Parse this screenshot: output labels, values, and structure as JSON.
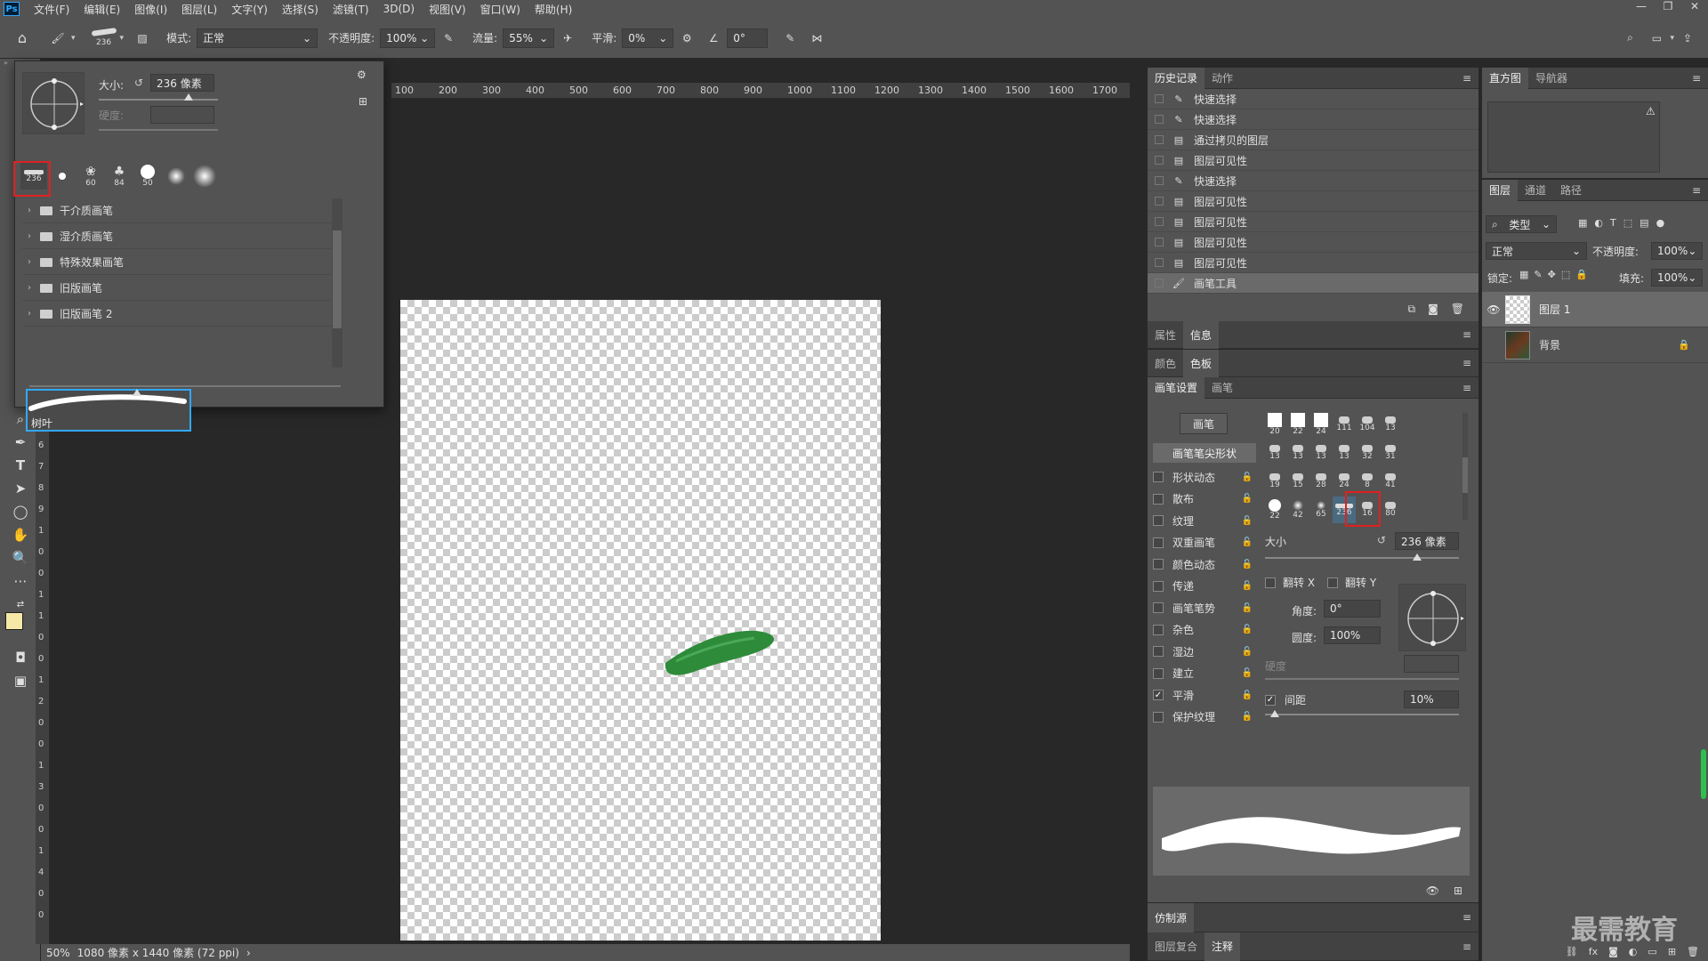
{
  "menubar": {
    "logo": "Ps",
    "items": [
      "文件(F)",
      "编辑(E)",
      "图像(I)",
      "图层(L)",
      "文字(Y)",
      "选择(S)",
      "滤镜(T)",
      "3D(D)",
      "视图(V)",
      "窗口(W)",
      "帮助(H)"
    ],
    "window_controls": [
      "—",
      "❐",
      "✕"
    ]
  },
  "options_bar": {
    "brush_size": "236",
    "mode_label": "模式:",
    "mode_value": "正常",
    "opacity_label": "不透明度:",
    "opacity_value": "100%",
    "flow_label": "流量:",
    "flow_value": "55%",
    "smooth_label": "平滑:",
    "smooth_value": "0%",
    "angle_value": "0°"
  },
  "brush_popup": {
    "size_label": "大小:",
    "size_value": "236 像素",
    "hardness_label": "硬度:",
    "presets": [
      {
        "label": "236"
      },
      {
        "label": ""
      },
      {
        "label": "60"
      },
      {
        "label": "84"
      },
      {
        "label": "50"
      },
      {
        "label": ""
      },
      {
        "label": ""
      }
    ],
    "folders": [
      "干介质画笔",
      "湿介质画笔",
      "特殊效果画笔",
      "旧版画笔",
      "旧版画笔 2"
    ],
    "selected_brush_name": "树叶"
  },
  "ruler_top": [
    "100",
    "200",
    "300",
    "400",
    "500",
    "600",
    "700",
    "800",
    "900",
    "1000",
    "1100",
    "1200",
    "1300",
    "1400",
    "1500",
    "1600",
    "1700"
  ],
  "ruler_left": [
    "5",
    "6",
    "7",
    "8",
    "9",
    "1",
    "0",
    "0",
    "1",
    "1",
    "0",
    "0",
    "1",
    "2",
    "0",
    "0",
    "1",
    "3",
    "0",
    "0",
    "1",
    "4",
    "0",
    "0"
  ],
  "status": {
    "zoom": "50%",
    "doc_info": "1080 像素 x 1440 像素 (72 ppi)",
    "arrow": "›"
  },
  "history_panel": {
    "tabs": [
      "历史记录",
      "动作"
    ],
    "items": [
      {
        "label": "快速选择",
        "icon": "quick-select-icon"
      },
      {
        "label": "快速选择",
        "icon": "quick-select-icon"
      },
      {
        "label": "通过拷贝的图层",
        "icon": "doc-icon"
      },
      {
        "label": "图层可见性",
        "icon": "doc-icon"
      },
      {
        "label": "快速选择",
        "icon": "quick-select-icon"
      },
      {
        "label": "图层可见性",
        "icon": "doc-icon"
      },
      {
        "label": "图层可见性",
        "icon": "doc-icon"
      },
      {
        "label": "图层可见性",
        "icon": "doc-icon"
      },
      {
        "label": "图层可见性",
        "icon": "doc-icon"
      },
      {
        "label": "画笔工具",
        "icon": "brush-icon"
      }
    ]
  },
  "histogram_panel": {
    "tabs": [
      "直方图",
      "导航器"
    ]
  },
  "props_tabs": [
    "属性",
    "信息"
  ],
  "color_tabs": [
    "颜色",
    "色板"
  ],
  "brush_settings": {
    "tabs": [
      "画笔设置",
      "画笔"
    ],
    "brushes_button": "画笔",
    "tip_shape_label": "画笔笔尖形状",
    "options": [
      {
        "label": "形状动态",
        "checked": false
      },
      {
        "label": "散布",
        "checked": false
      },
      {
        "label": "纹理",
        "checked": false
      },
      {
        "label": "双重画笔",
        "checked": false
      },
      {
        "label": "颜色动态",
        "checked": false
      },
      {
        "label": "传递",
        "checked": false
      },
      {
        "label": "画笔笔势",
        "checked": false
      },
      {
        "label": "杂色",
        "checked": false
      },
      {
        "label": "湿边",
        "checked": false
      },
      {
        "label": "建立",
        "checked": false
      },
      {
        "label": "平滑",
        "checked": true
      },
      {
        "label": "保护纹理",
        "checked": false
      }
    ],
    "tip_grid": [
      "20",
      "22",
      "24",
      "111",
      "104",
      "13",
      "13",
      "13",
      "13",
      "13",
      "32",
      "31",
      "19",
      "15",
      "28",
      "24",
      "8",
      "41",
      "22",
      "42",
      "65",
      "236",
      "16",
      "80"
    ],
    "size_label": "大小",
    "size_value": "236 像素",
    "flip_x": "翻转 X",
    "flip_y": "翻转 Y",
    "angle_label": "角度:",
    "angle_value": "0°",
    "roundness_label": "圆度:",
    "roundness_value": "100%",
    "hardness_label": "硬度",
    "spacing_label": "间距",
    "spacing_value": "10%"
  },
  "clone_source_tab": "仿制源",
  "bottom_tabs": [
    "图层复合",
    "注释"
  ],
  "layers_panel": {
    "tabs": [
      "图层",
      "通道",
      "路径"
    ],
    "filter_label": "类型",
    "blend_mode": "正常",
    "opacity_label": "不透明度:",
    "opacity_value": "100%",
    "lock_label": "锁定:",
    "fill_label": "填充:",
    "fill_value": "100%",
    "layers": [
      {
        "name": "图层 1",
        "visible": true,
        "selected": true
      },
      {
        "name": "背景",
        "visible": false,
        "selected": false
      }
    ]
  },
  "watermark": "最需教育",
  "colors": {
    "accent_red": "#e02020",
    "leaf_green": "#2e8b3a",
    "fg_color": "#f5e9a8",
    "bg_color": "#29b6c8"
  }
}
